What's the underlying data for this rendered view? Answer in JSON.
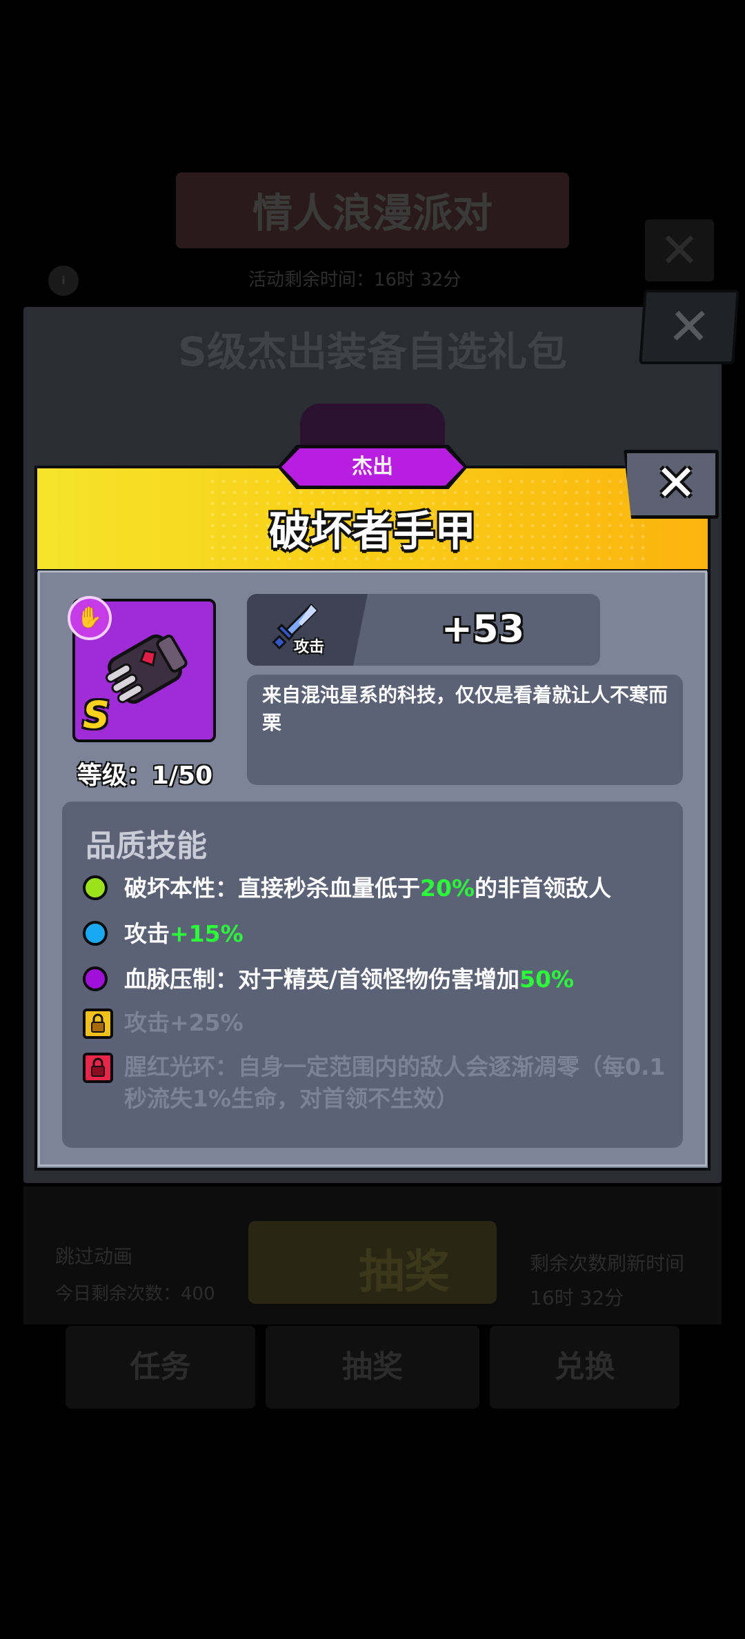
{
  "background": {
    "event_title": "情人浪漫派对",
    "event_timer": "活动剩余时间：16时 32分",
    "panel_title": "S级杰出装备自选礼包",
    "skip_animation": "跳过动画",
    "remaining_today": "今日剩余次数：400",
    "draw_button": "抽奖",
    "refresh_label": "剩余次数刷新时间",
    "refresh_time": "16时 32分",
    "tabs": [
      "任务",
      "抽奖",
      "兑换"
    ]
  },
  "dialog": {
    "rarity": "杰出",
    "title": "破坏者手甲",
    "close_glyph": "✕",
    "grade": "S",
    "slot_icon": "hand-icon",
    "level": "等级：1/50",
    "stat": {
      "label": "攻击",
      "value": "+53"
    },
    "description": "来自混沌星系的科技，仅仅是看着就让人不寒而栗",
    "skills_title": "品质技能",
    "skills": [
      {
        "color": "#9be21a",
        "locked": false,
        "prefix": "破坏本性：直接秒杀血量低于",
        "highlight": "20%",
        "suffix": "的非首领敌人"
      },
      {
        "color": "#19a8f2",
        "locked": false,
        "prefix": "攻击",
        "highlight": "+15%",
        "suffix": ""
      },
      {
        "color": "#a010d8",
        "locked": false,
        "prefix": "血脉压制：对于精英/首领怪物伤害增加",
        "highlight": "50%",
        "suffix": ""
      },
      {
        "color": "#f2c21a",
        "locked": true,
        "prefix": "攻击+25%",
        "highlight": "",
        "suffix": ""
      },
      {
        "color": "#e8264a",
        "locked": true,
        "prefix": "腥红光环：自身一定范围内的敌人会逐渐凋零（每0.1秒流失1%生命，对首领不生效）",
        "highlight": "",
        "suffix": ""
      }
    ]
  }
}
